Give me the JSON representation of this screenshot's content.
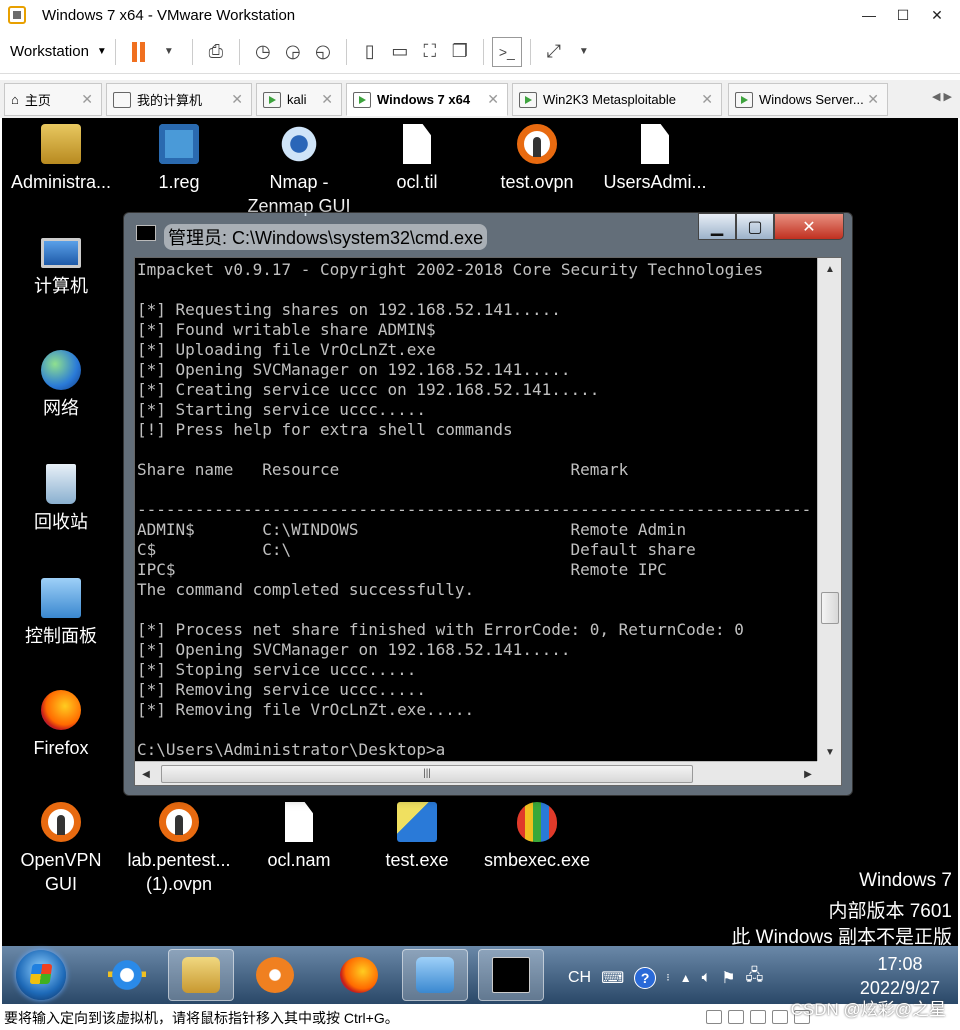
{
  "window": {
    "title": "Windows 7 x64 - VMware Workstation",
    "minimize": "—",
    "maximize": "☐",
    "close": "✕"
  },
  "toolbar": {
    "menu_label": "Workstation",
    "menu_arrow": "▼"
  },
  "tabs": [
    {
      "label": "主页"
    },
    {
      "label": "我的计算机"
    },
    {
      "label": "kali"
    },
    {
      "label": "Windows 7 x64"
    },
    {
      "label": "Win2K3 Metasploitable"
    },
    {
      "label": "Windows Server..."
    }
  ],
  "desktop": {
    "icons": [
      {
        "label": "Administra...",
        "icon": "user-folder-icon"
      },
      {
        "label": "1.reg",
        "icon": "registry-file-icon"
      },
      {
        "label": "Nmap - Zenmap GUI",
        "icon": "zenmap-icon"
      },
      {
        "label": "ocl.til",
        "icon": "file-icon"
      },
      {
        "label": "test.ovpn",
        "icon": "openvpn-icon"
      },
      {
        "label": "UsersAdmi...",
        "icon": "file-icon"
      },
      {
        "label": "计算机",
        "icon": "computer-icon"
      },
      {
        "label": "网络",
        "icon": "network-icon"
      },
      {
        "label": "回收站",
        "icon": "recycle-bin-icon"
      },
      {
        "label": "控制面板",
        "icon": "control-panel-icon"
      },
      {
        "label": "Firefox",
        "icon": "firefox-icon"
      },
      {
        "label": "OpenVPN GUI",
        "icon": "openvpn-icon"
      },
      {
        "label": "lab.pentest... (1).ovpn",
        "icon": "openvpn-icon"
      },
      {
        "label": "ocl.nam",
        "icon": "file-icon"
      },
      {
        "label": "test.exe",
        "icon": "exe-icon"
      },
      {
        "label": "smbexec.exe",
        "icon": "balloon-icon"
      }
    ],
    "watermark": [
      "Windows 7",
      "内部版本 7601",
      "此 Windows 副本不是正版"
    ]
  },
  "cmd": {
    "title": "管理员: C:\\Windows\\system32\\cmd.exe",
    "lines": [
      "Impacket v0.9.17 - Copyright 2002-2018 Core Security Technologies",
      "",
      "[*] Requesting shares on 192.168.52.141.....",
      "[*] Found writable share ADMIN$",
      "[*] Uploading file VrOcLnZt.exe",
      "[*] Opening SVCManager on 192.168.52.141.....",
      "[*] Creating service uccc on 192.168.52.141.....",
      "[*] Starting service uccc.....",
      "[!] Press help for extra shell commands",
      "",
      "Share name   Resource                        Remark",
      "",
      "-------------------------------------------------------------------------------",
      "ADMIN$       C:\\WINDOWS                      Remote Admin",
      "C$           C:\\                             Default share",
      "IPC$                                         Remote IPC",
      "The command completed successfully.",
      "",
      "[*] Process net share finished with ErrorCode: 0, ReturnCode: 0",
      "[*] Opening SVCManager on 192.168.52.141.....",
      "[*] Stoping service uccc.....",
      "[*] Removing service uccc.....",
      "[*] Removing file VrOcLnZt.exe.....",
      "",
      "C:\\Users\\Administrator\\Desktop>a"
    ]
  },
  "taskbar": {
    "tray_lang": "CH",
    "tray_help": "?",
    "tray_up": "▲",
    "time": "17:08",
    "date": "2022/9/27"
  },
  "statusbar": {
    "hint": "要将输入定向到该虚拟机，请将鼠标指针移入其中或按 Ctrl+G。",
    "watermark": "CSDN @炫彩@之星"
  }
}
